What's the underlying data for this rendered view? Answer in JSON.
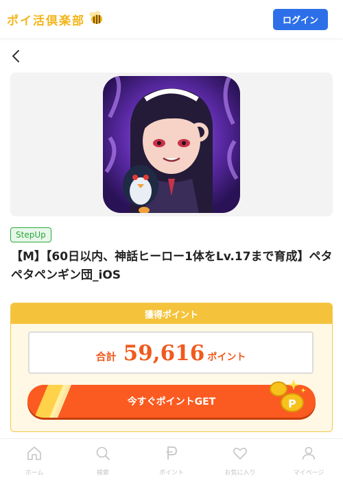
{
  "header": {
    "logo_text": "ポイ活倶楽部",
    "logo_icon": "bee-icon",
    "login_label": "ログイン"
  },
  "nav": {
    "back_icon": "chevron-left-icon"
  },
  "offer": {
    "image_icon": "game-app-icon",
    "badge": "StepUp",
    "title": "【M】【60日以内、神話ヒーロー1体をLv.17まで育成】ペタペタペンギン団_iOS"
  },
  "points": {
    "header_label": "獲得ポイント",
    "total_label": "合計",
    "total_value": "59,616",
    "unit_label": "ポイント",
    "cta_label": "今すぐポイントGET"
  },
  "bottom_nav": {
    "items": [
      {
        "label": "ホーム",
        "icon": "home-icon"
      },
      {
        "label": "検索",
        "icon": "search-icon"
      },
      {
        "label": "ポイント",
        "icon": "point-icon"
      },
      {
        "label": "お気に入り",
        "icon": "heart-icon"
      },
      {
        "label": "マイページ",
        "icon": "user-icon"
      }
    ]
  },
  "colors": {
    "brand_yellow": "#f3b51a",
    "login_blue": "#2d6fe8",
    "badge_green": "#29a83b",
    "points_orange": "#f05a1e",
    "cta_orange": "#fb5b20"
  }
}
